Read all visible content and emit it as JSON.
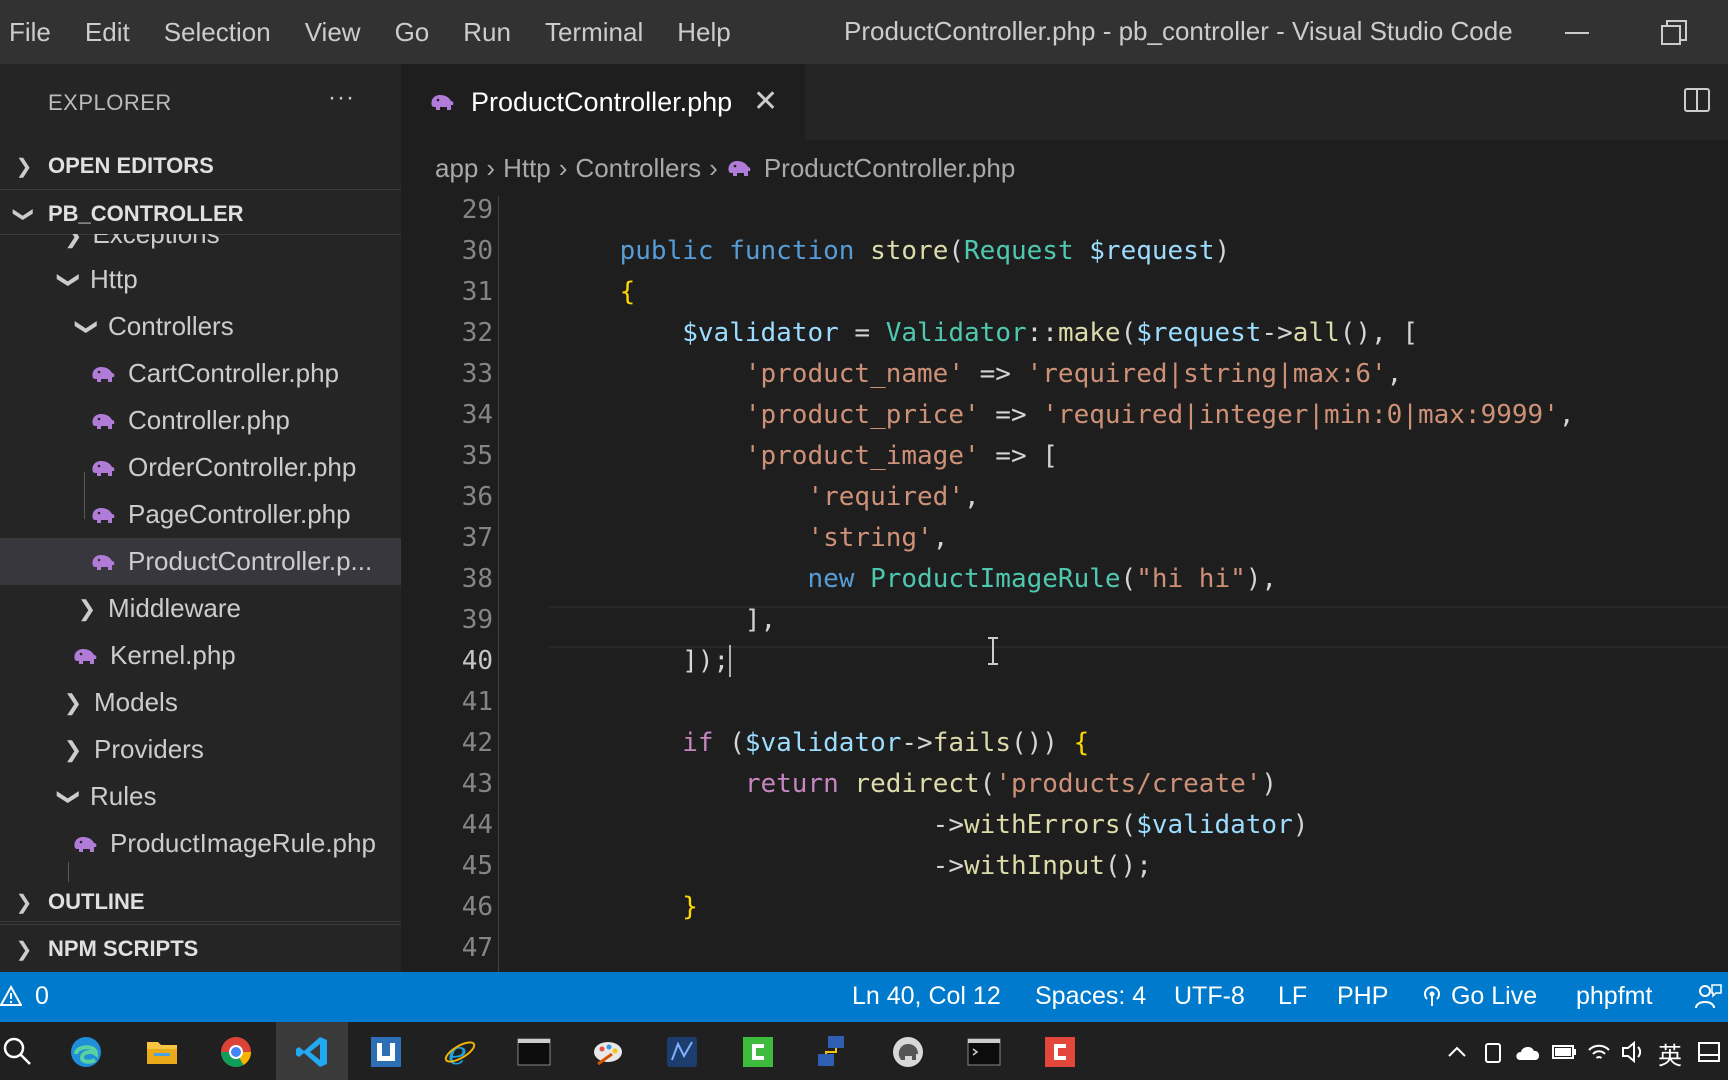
{
  "titlebar": {
    "menu": [
      "File",
      "Edit",
      "Selection",
      "View",
      "Go",
      "Run",
      "Terminal",
      "Help"
    ],
    "window_title": "ProductController.php - pb_controller - Visual Studio Code"
  },
  "sidebar": {
    "title": "EXPLORER",
    "more": "···",
    "sections": {
      "open_editors": "OPEN EDITORS",
      "project": "PB_CONTROLLER",
      "outline": "OUTLINE",
      "npm_scripts": "NPM SCRIPTS"
    },
    "tree": [
      {
        "label": "Exceptions",
        "type": "folder",
        "expanded": false
      },
      {
        "label": "Http",
        "type": "folder",
        "expanded": true
      },
      {
        "label": "Controllers",
        "type": "folder",
        "expanded": true
      },
      {
        "label": "CartController.php",
        "type": "php"
      },
      {
        "label": "Controller.php",
        "type": "php"
      },
      {
        "label": "OrderController.php",
        "type": "php"
      },
      {
        "label": "PageController.php",
        "type": "php"
      },
      {
        "label": "ProductController.p...",
        "type": "php",
        "selected": true
      },
      {
        "label": "Middleware",
        "type": "folder",
        "expanded": false
      },
      {
        "label": "Kernel.php",
        "type": "php"
      },
      {
        "label": "Models",
        "type": "folder",
        "expanded": false
      },
      {
        "label": "Providers",
        "type": "folder",
        "expanded": false
      },
      {
        "label": "Rules",
        "type": "folder",
        "expanded": true
      },
      {
        "label": "ProductImageRule.php",
        "type": "php"
      }
    ]
  },
  "editor": {
    "tab_label": "ProductController.php",
    "close_glyph": "✕",
    "breadcrumb": [
      "app",
      "Http",
      "Controllers",
      "ProductController.php"
    ],
    "active_line": 40,
    "lines": [
      {
        "n": "29",
        "t": ""
      },
      {
        "n": "30",
        "t": "    public function store(Request $request)"
      },
      {
        "n": "31",
        "t": "    {"
      },
      {
        "n": "32",
        "t": "        $validator = Validator::make($request->all(), ["
      },
      {
        "n": "33",
        "t": "            'product_name' => 'required|string|max:6',"
      },
      {
        "n": "34",
        "t": "            'product_price' => 'required|integer|min:0|max:9999',"
      },
      {
        "n": "35",
        "t": "            'product_image' => ["
      },
      {
        "n": "36",
        "t": "                'required',"
      },
      {
        "n": "37",
        "t": "                'string',"
      },
      {
        "n": "38",
        "t": "                new ProductImageRule(\"hi hi\"),"
      },
      {
        "n": "39",
        "t": "            ],"
      },
      {
        "n": "40",
        "t": "        ]);"
      },
      {
        "n": "41",
        "t": ""
      },
      {
        "n": "42",
        "t": "        if ($validator->fails()) {"
      },
      {
        "n": "43",
        "t": "            return redirect('products/create')"
      },
      {
        "n": "44",
        "t": "                        ->withErrors($validator)"
      },
      {
        "n": "45",
        "t": "                        ->withInput();"
      },
      {
        "n": "46",
        "t": "        }"
      },
      {
        "n": "47",
        "t": ""
      }
    ]
  },
  "statusbar": {
    "problems": "0",
    "position": "Ln 40, Col 12",
    "spaces": "Spaces: 4",
    "encoding": "UTF-8",
    "eol": "LF",
    "language": "PHP",
    "go_live": "Go Live",
    "formatter": "phpfmt"
  },
  "taskbar": {
    "icons": [
      "search-icon",
      "edge-icon",
      "file-explorer-icon",
      "chrome-icon",
      "vscode-icon",
      "app-icon",
      "internet-explorer-icon",
      "terminal-icon",
      "paint-icon",
      "network-icon",
      "green-app-icon",
      "network-tool-icon",
      "php-icon",
      "cmd-icon",
      "red-app-icon"
    ],
    "ime": "英"
  },
  "colors": {
    "accent": "#007acc",
    "php_icon": "#b07cd8",
    "keyword": "#569cd6",
    "function": "#dcdcaa",
    "class": "#4ec9b0",
    "variable": "#9cdcfe",
    "string": "#ce9178",
    "control": "#c586c0"
  }
}
